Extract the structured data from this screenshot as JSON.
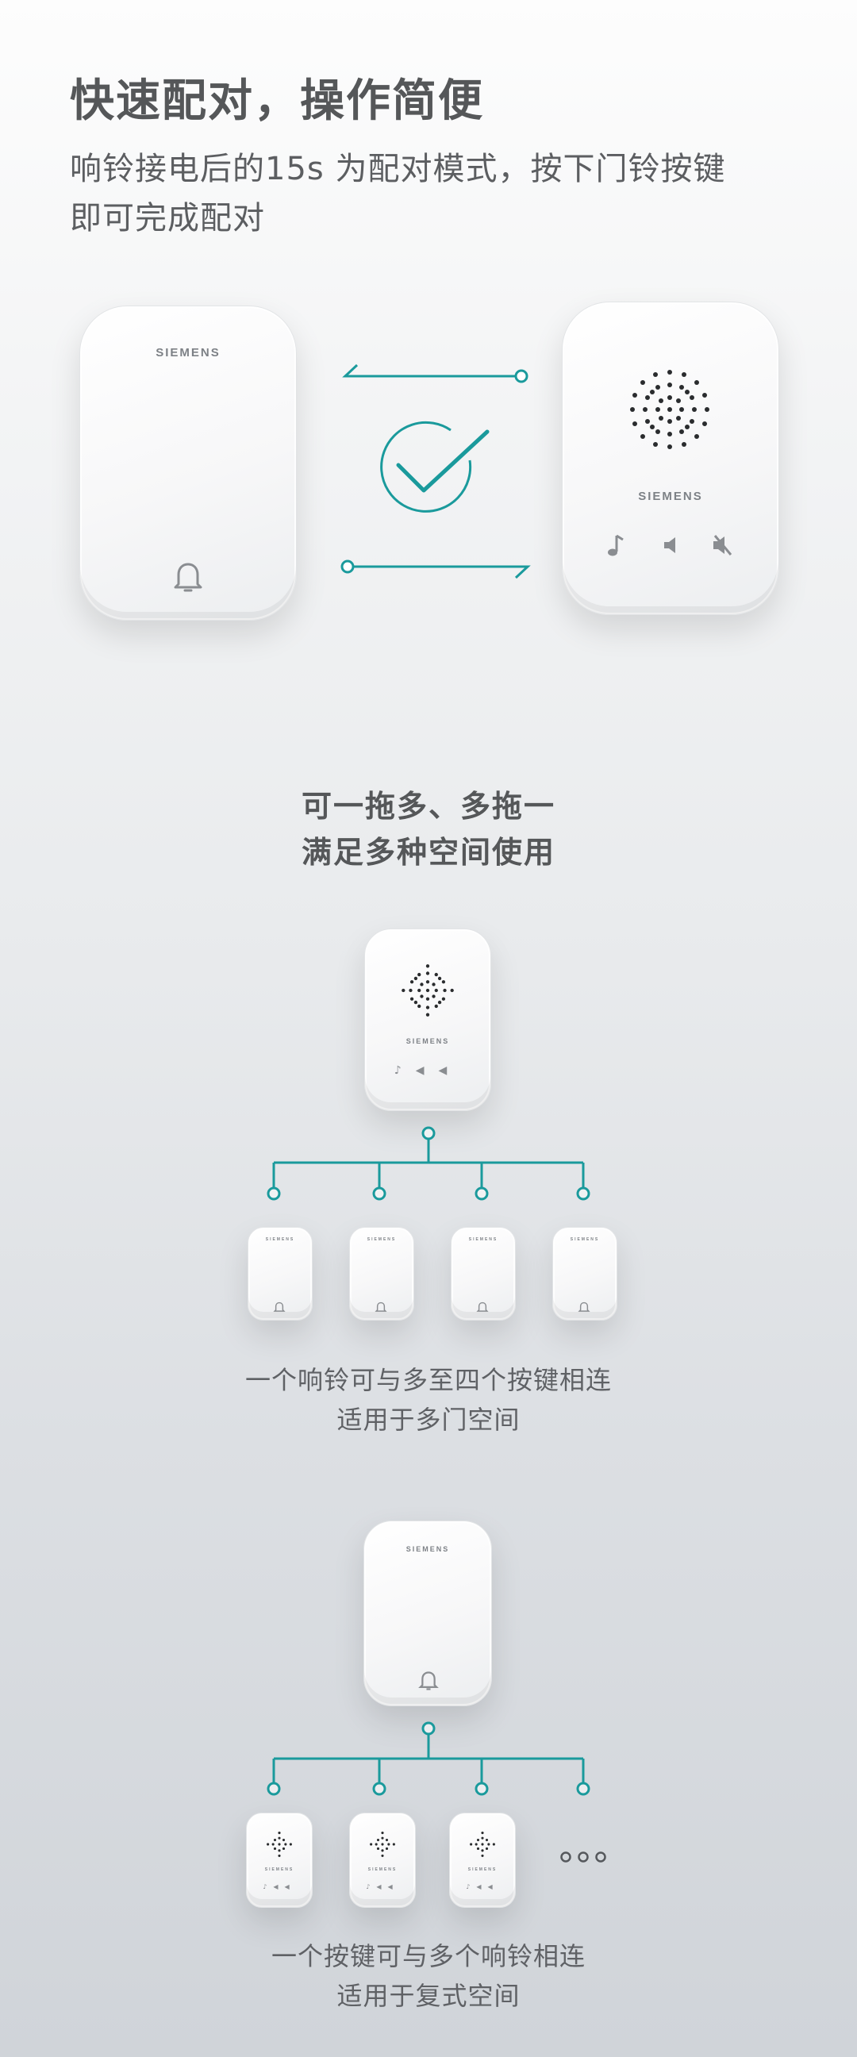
{
  "header": {
    "title": "快速配对，操作简便",
    "desc_line1": "响铃接电后的15s 为配对模式，按下门铃按键",
    "desc_line2": "即可完成配对"
  },
  "pairing": {
    "button_brand": "SIEMENS",
    "receiver_brand": "SIEMENS"
  },
  "section_one_to_many": {
    "heading_line1": "可一拖多、多拖一",
    "heading_line2": "满足多种空间使用"
  },
  "diagram_one_receiver": {
    "receiver_brand": "SIEMENS",
    "button_brands": [
      "SIEMENS",
      "SIEMENS",
      "SIEMENS",
      "SIEMENS"
    ],
    "caption_line1": "一个响铃可与多至四个按键相连",
    "caption_line2": "适用于多门空间"
  },
  "diagram_one_button": {
    "button_brand": "SIEMENS",
    "receiver_brands": [
      "SIEMENS",
      "SIEMENS",
      "SIEMENS"
    ],
    "caption_line1": "一个按键可与多个响铃相连",
    "caption_line2": "适用于复式空间"
  },
  "colors": {
    "accent_teal": "#1a9a9c",
    "text_gray": "#555759"
  },
  "icons": [
    "bell-icon",
    "speaker-grille-icon",
    "music-note-icon",
    "volume-icon",
    "mute-icon",
    "check-circle-icon",
    "more-dots-icon"
  ]
}
